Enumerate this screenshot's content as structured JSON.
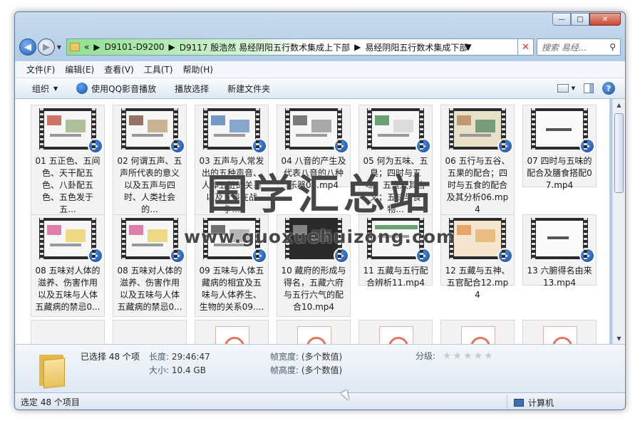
{
  "window": {
    "buttons": {
      "minimize": "—",
      "maximize": "□",
      "close": "✕"
    }
  },
  "address": {
    "prefix": "«",
    "crumbs": [
      "D9101-D9200",
      "D9117 殷浩然 易经阴阳五行数术集成上下部",
      "易经阴阳五行数术集成下部"
    ],
    "search_placeholder": "搜索 易经...",
    "progress": 0.52
  },
  "menu": [
    "文件(F)",
    "编辑(E)",
    "查看(V)",
    "工具(T)",
    "帮助(H)"
  ],
  "toolbar": {
    "organize": "组织",
    "qq_play": "使用QQ影音播放",
    "play_selection": "播放选择",
    "new_folder": "新建文件夹"
  },
  "files_row1": [
    "01 五正色、五间色、天干配五色、八卦配五色、五色发于五...",
    "02 何谓五声、五声所代表的意义以及五声与四时、人类社会的...",
    "03 五声与人常发出的五种声音、人体五脏的关系以及五声在战争...",
    "04 八音的产生及代表八音的八种乐器04.mp4",
    "05 何为五味、五臭；四时与五味、五臭及其含义；五味与食物...",
    "06 五行与五谷、五果的配合；四时与五食的配合及其分析06.mp4",
    "07 四时与五味的配合及膳食搭配07.mp4"
  ],
  "files_row2": [
    "08 五味对人体的滋养、伤害作用以及五味与人体五藏病的禁忌0...",
    "08 五味对人体的滋养、伤害作用以及五味与人体五藏病的禁忌0...",
    "09 五味与人体五藏病的相宜及五味与人体养生、生物的关系09....",
    "10 藏府的形成与得名，五藏六府与五行六气的配合10.mp4",
    "11 五藏与五行配合辨析11.mp4",
    "12 五藏与五神、五官配合12.mp4",
    "13 六腑得名由来13.mp4"
  ],
  "watermark": {
    "title": "国学汇总站",
    "url": "www.guoxuehuizong.com"
  },
  "details": {
    "selected": "已选择 48 个项",
    "length_key": "长度:",
    "length_val": "29:46:47",
    "size_key": "大小:",
    "size_val": "10.4 GB",
    "width_key": "帧宽度:",
    "width_val": "(多个数值)",
    "height_key": "帧高度:",
    "height_val": "(多个数值)",
    "rating_key": "分级:",
    "rating_stars": 0
  },
  "status": {
    "left": "选定 48 个项目",
    "right": "计算机"
  }
}
